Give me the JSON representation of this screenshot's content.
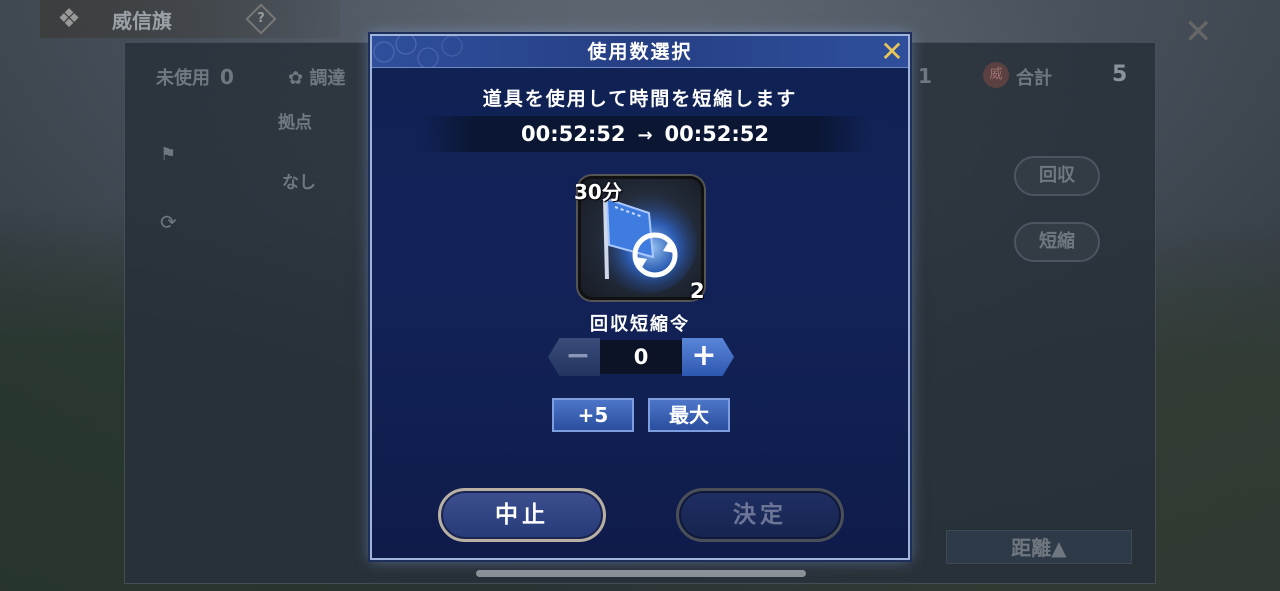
{
  "background": {
    "top_title": "威信旗",
    "help_icon": "?",
    "close_icon": "✕",
    "unused_label": "未使用",
    "unused_count": "0",
    "procure_label": "調達",
    "count_one": "1",
    "total_badge": "威",
    "total_label": "合計",
    "total_count": "5",
    "base_label": "拠点",
    "none_label": "なし",
    "recover_button": "回収",
    "shorten_button": "短縮",
    "distance_button": "距離▲"
  },
  "modal": {
    "title": "使用数選択",
    "close_icon": "✕",
    "description": "道具を使用して時間を短縮します",
    "time_before": "00:52:52",
    "time_arrow": "→",
    "time_after": "00:52:52",
    "item": {
      "icon": "blue-flag-refresh-icon",
      "duration_label": "30分",
      "owned_count": "2",
      "name": "回収短縮令"
    },
    "stepper": {
      "minus_label": "−",
      "value": "0",
      "plus_label": "+"
    },
    "quick_buttons": {
      "plus5": "+5",
      "max": "最大"
    },
    "cancel_button": "中止",
    "confirm_button": "決定"
  },
  "colors": {
    "modal_bg": "#13235a",
    "accent_gold": "#e8c65a",
    "button_blue": "#4d76c8"
  }
}
